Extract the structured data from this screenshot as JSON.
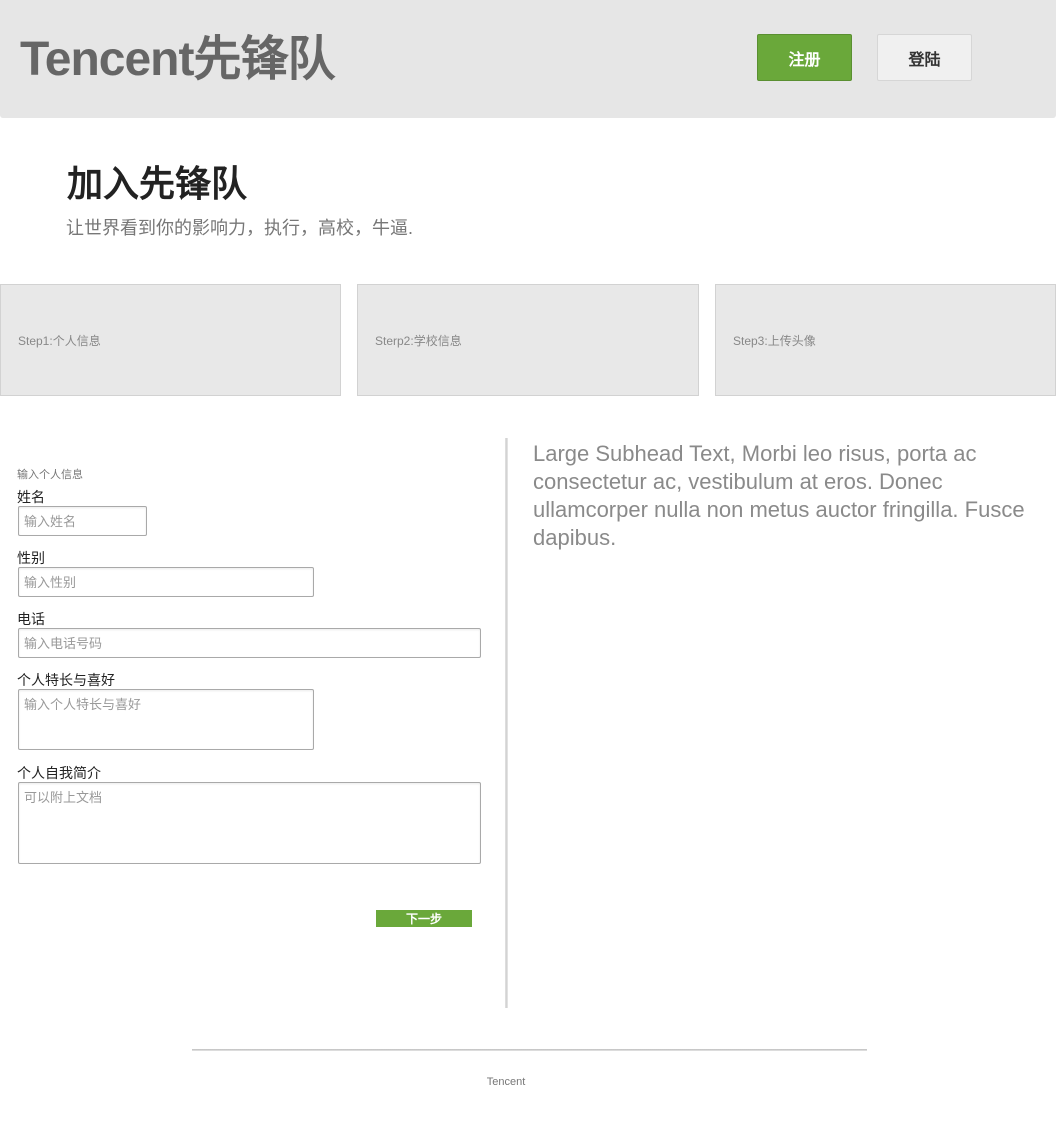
{
  "header": {
    "brand": "Tencent先锋队",
    "register_label": "注册",
    "login_label": "登陆"
  },
  "hero": {
    "title": "加入先锋队",
    "subtitle": "让世界看到你的影响力，执行，高校，牛逼."
  },
  "steps": [
    {
      "label": "Step1:个人信息"
    },
    {
      "label": "Sterp2:学校信息"
    },
    {
      "label": "Step3:上传头像"
    }
  ],
  "form": {
    "caption": "输入个人信息",
    "name": {
      "label": "姓名",
      "placeholder": "输入姓名",
      "value": ""
    },
    "gender": {
      "label": "性别",
      "placeholder": "输入性别",
      "value": ""
    },
    "phone": {
      "label": "电话",
      "placeholder": "输入电话号码",
      "value": ""
    },
    "hobbies": {
      "label": "个人特长与喜好",
      "placeholder": "输入个人特长与喜好",
      "value": ""
    },
    "intro": {
      "label": "个人自我简介",
      "placeholder": "可以附上文档",
      "value": ""
    },
    "next_label": "下一步"
  },
  "aside": {
    "subhead": "Large Subhead Text, Morbi leo risus, porta ac consectetur ac, vestibulum at eros. Donec ullamcorper nulla non metus auctor fringilla. Fusce dapibus."
  },
  "footer": {
    "text": "Tencent"
  },
  "colors": {
    "accent": "#6aa83a",
    "header_bg": "#e6e6e6",
    "step_bg": "#e8e8e8"
  }
}
